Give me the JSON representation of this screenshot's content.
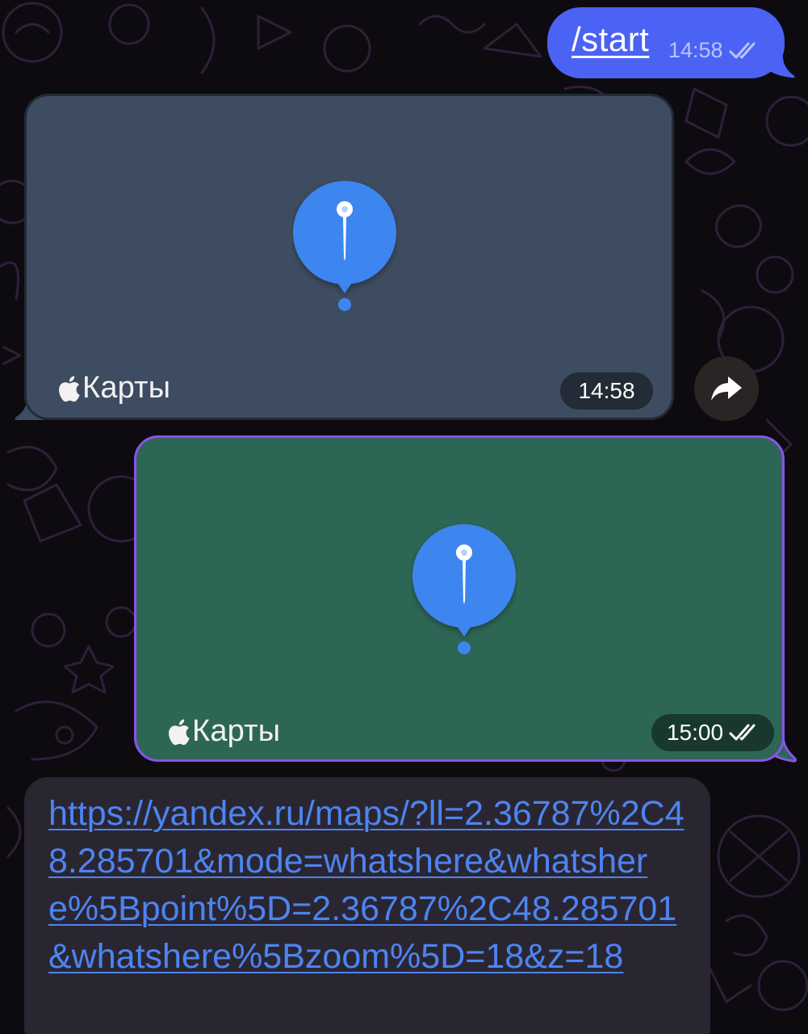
{
  "messages": {
    "start": {
      "text": "/start",
      "time": "14:58",
      "status_icon": "double-check-icon"
    },
    "location_incoming": {
      "brand": "Карты",
      "brand_icon": "apple-logo-icon",
      "time": "14:58"
    },
    "location_outgoing": {
      "brand": "Карты",
      "brand_icon": "apple-logo-icon",
      "time": "15:00",
      "status_icon": "double-check-icon"
    },
    "link": {
      "url": "https://yandex.ru/maps/?ll=2.36787%2C48.285701&mode=whatshere&whatshere%5Bpoint%5D=2.36787%2C48.285701&whatshere%5Bzoom%5D=18&z=18"
    }
  },
  "actions": {
    "forward_icon": "share-arrow-icon"
  },
  "colors": {
    "outgoing_bubble": "#4a63f5",
    "incoming_location_bg": "#3e4c61",
    "outgoing_location_bg": "#2e6656",
    "outgoing_location_border": "#8a52ee",
    "pin_blue": "#3d86f0",
    "link_color": "#4d84f2"
  }
}
